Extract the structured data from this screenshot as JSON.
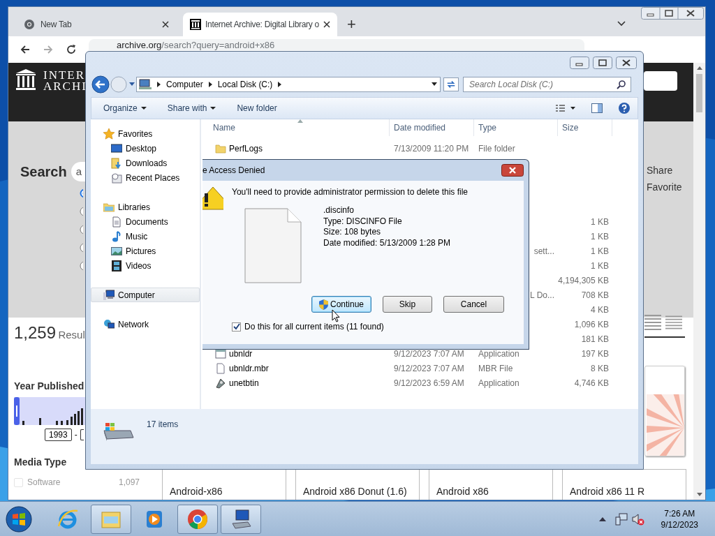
{
  "browser": {
    "tabs": [
      {
        "title": "New Tab",
        "kind": "chrome",
        "selected": false
      },
      {
        "title": "Internet Archive: Digital Library o",
        "kind": "archive",
        "selected": true
      }
    ],
    "new_tab": "+",
    "address": {
      "host": "archive.org",
      "path": "/search?query=android+x86"
    },
    "page": {
      "logo": [
        "INTER",
        "ARCHI"
      ],
      "search_label": "Search",
      "search_value": "a",
      "radios": [
        {
          "selected": true
        },
        {
          "selected": false
        },
        {
          "selected": false
        },
        {
          "selected": false
        },
        {
          "selected": false
        }
      ],
      "actions": [
        "Share",
        "Favorite"
      ],
      "results_count": "1,259",
      "results_label": "Resul",
      "year": {
        "title": "Year Published",
        "from": "1993",
        "separator": "-"
      },
      "media": {
        "title": "Media Type",
        "options": [
          {
            "label": "Software",
            "count": "1,097",
            "checked": false
          }
        ]
      },
      "cards": [
        {
          "title": "Android-x86"
        },
        {
          "title": "Android x86 Donut (1.6)"
        },
        {
          "title": "Android x86"
        },
        {
          "title": "Android x86 11 R"
        }
      ]
    }
  },
  "explorer": {
    "breadcrumb": [
      "Computer",
      "Local Disk (C:)"
    ],
    "search_placeholder": "Search Local Disk (C:)",
    "toolbar": [
      {
        "label": "Organize",
        "menu": true
      },
      {
        "label": "Share with",
        "menu": true
      },
      {
        "label": "New folder",
        "menu": false
      }
    ],
    "nav": [
      {
        "label": "Favorites",
        "kind": "star",
        "selected": false,
        "children": [
          {
            "label": "Desktop",
            "kind": "desktop",
            "selected": false
          },
          {
            "label": "Downloads",
            "kind": "downloads",
            "selected": false
          },
          {
            "label": "Recent Places",
            "kind": "recent",
            "selected": false
          }
        ]
      },
      {
        "label": "Libraries",
        "kind": "library",
        "selected": false,
        "children": [
          {
            "label": "Documents",
            "kind": "documents",
            "selected": false
          },
          {
            "label": "Music",
            "kind": "music",
            "selected": false
          },
          {
            "label": "Pictures",
            "kind": "pictures",
            "selected": false
          },
          {
            "label": "Videos",
            "kind": "videos",
            "selected": false
          }
        ]
      },
      {
        "label": "Computer",
        "kind": "computer",
        "selected": true
      },
      {
        "label": "Network",
        "kind": "network",
        "selected": false
      }
    ],
    "columns": [
      "Name",
      "Date modified",
      "Type",
      "Size"
    ],
    "rows": [
      {
        "kind": "folder",
        "name": "PerfLogs",
        "date": "7/13/2009 11:20 PM",
        "type": "File folder"
      },
      {
        "kind": "partial",
        "size": "1 KB"
      },
      {
        "kind": "partial",
        "size": "1 KB"
      },
      {
        "kind": "partial",
        "type": "sett...",
        "size": "1 KB"
      },
      {
        "kind": "partial",
        "size": "1 KB"
      },
      {
        "kind": "partial",
        "size": "4,194,305 KB"
      },
      {
        "kind": "partial",
        "type": "L Do...",
        "size": "708 KB"
      },
      {
        "kind": "partial",
        "size": "4 KB"
      },
      {
        "kind": "partial",
        "size": "1,096 KB"
      },
      {
        "kind": "partial",
        "size": "181 KB"
      },
      {
        "kind": "app",
        "name": "ubnldr",
        "date": "9/12/2023 7:07 AM",
        "type": "Application",
        "size": "197 KB"
      },
      {
        "kind": "file",
        "name": "ubnldr.mbr",
        "date": "9/12/2023 7:07 AM",
        "type": "MBR File",
        "size": "8 KB"
      },
      {
        "kind": "setup",
        "name": "unetbtin",
        "date": "9/12/2023 6:59 AM",
        "type": "Application",
        "size": "4,746 KB"
      }
    ],
    "status": "17 items"
  },
  "dialog": {
    "title": "e Access Denied",
    "message": "You'll need to provide administrator permission to delete this file",
    "file": [
      ".discinfo",
      "Type: DISCINFO File",
      "Size: 108 bytes",
      "Date modified: 5/13/2009 1:28 PM"
    ],
    "buttons": [
      {
        "label": "Continue",
        "kind": "elevated",
        "focused": true
      },
      {
        "label": "Skip",
        "kind": "plain",
        "focused": false
      },
      {
        "label": "Cancel",
        "kind": "plain",
        "focused": false
      }
    ],
    "apply_all": {
      "label": "Do this for all current items (11 found)",
      "checked": true
    }
  },
  "taskbar": {
    "apps": [
      {
        "kind": "ie",
        "active": false
      },
      {
        "kind": "explorer",
        "active": true
      },
      {
        "kind": "media",
        "active": false
      },
      {
        "kind": "chrome",
        "active": true
      },
      {
        "kind": "computer",
        "active": true
      }
    ],
    "time": "7:26 AM",
    "date": "9/12/2023"
  }
}
